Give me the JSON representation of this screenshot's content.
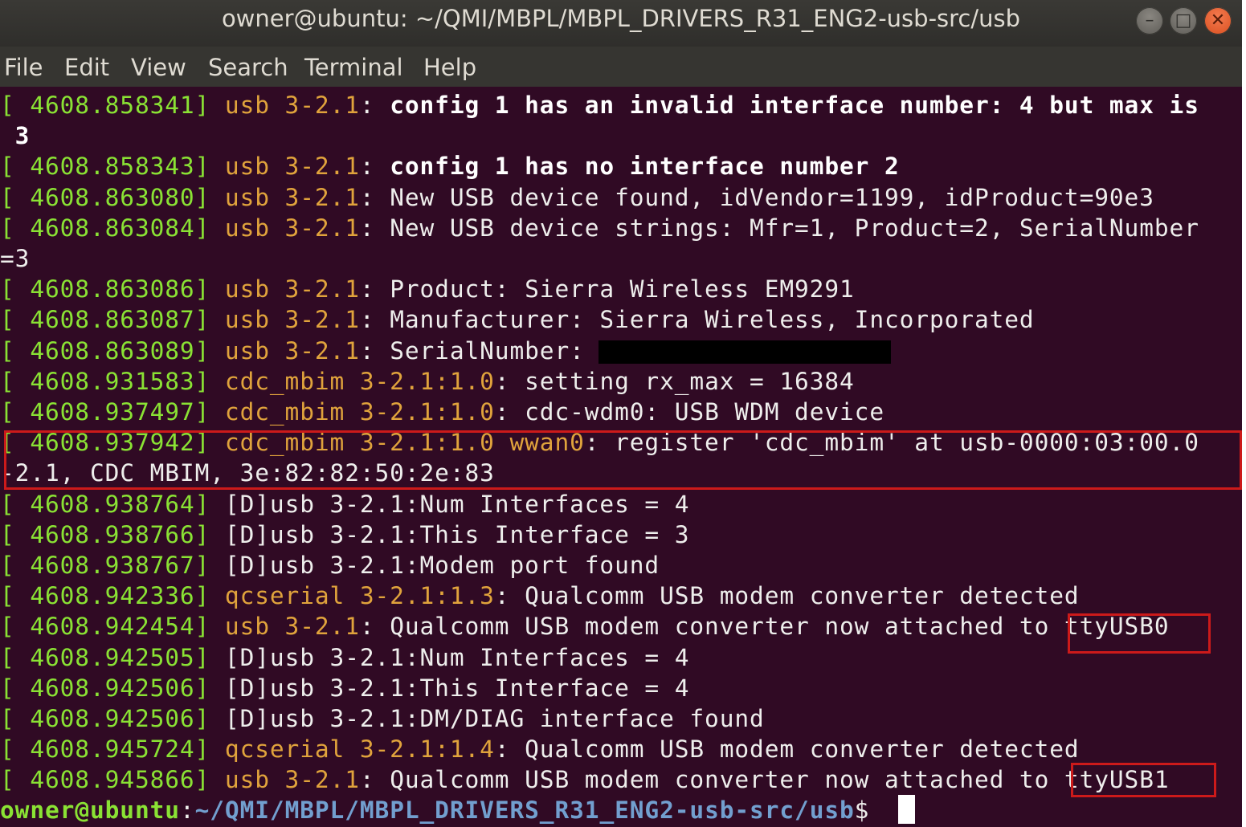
{
  "window": {
    "title": "owner@ubuntu: ~/QMI/MBPL/MBPL_DRIVERS_R31_ENG2-usb-src/usb",
    "buttons": {
      "minimize": "–",
      "maximize": "□",
      "close": "✕"
    }
  },
  "menu": [
    "File",
    "Edit",
    "View",
    "Search",
    "Terminal",
    "Help"
  ],
  "terminal": {
    "lines": [
      {
        "ts": "[ 4608.858341]",
        "dev": " usb 3-2.1",
        "sep": ": ",
        "msg": "config 1 has an invalid interface number: 4 but max is",
        "bold": true
      },
      {
        "msg": " 3",
        "bold": true
      },
      {
        "ts": "[ 4608.858343]",
        "dev": " usb 3-2.1",
        "sep": ": ",
        "msg": "config 1 has no interface number 2",
        "bold": true
      },
      {
        "ts": "[ 4608.863080]",
        "dev": " usb 3-2.1",
        "sep": ": ",
        "msg": "New USB device found, idVendor=1199, idProduct=90e3"
      },
      {
        "ts": "[ 4608.863084]",
        "dev": " usb 3-2.1",
        "sep": ": ",
        "msg": "New USB device strings: Mfr=1, Product=2, SerialNumber"
      },
      {
        "msg": "=3"
      },
      {
        "ts": "[ 4608.863086]",
        "dev": " usb 3-2.1",
        "sep": ": ",
        "msg": "Product: Sierra Wireless EM9291"
      },
      {
        "ts": "[ 4608.863087]",
        "dev": " usb 3-2.1",
        "sep": ": ",
        "msg": "Manufacturer: Sierra Wireless, Incorporated"
      },
      {
        "ts": "[ 4608.863089]",
        "dev": " usb 3-2.1",
        "sep": ": ",
        "msg": "SerialNumber:"
      },
      {
        "ts": "[ 4608.931583]",
        "dev": " cdc_mbim 3-2.1:1.0",
        "sep": ": ",
        "msg": "setting rx_max = 16384"
      },
      {
        "ts": "[ 4608.937497]",
        "dev": " cdc_mbim 3-2.1:1.0",
        "sep": ": ",
        "msg": "cdc-wdm0: USB WDM device"
      },
      {
        "ts": "[ 4608.937942]",
        "dev": " cdc_mbim 3-2.1:1.0 wwan0",
        "sep": ": ",
        "msg": "register 'cdc_mbim' at usb-0000:03:00.0"
      },
      {
        "msg": "-2.1, CDC MBIM, 3e:82:82:50:2e:83"
      },
      {
        "ts": "[ 4608.938764]",
        "dev": "",
        "sep": " ",
        "msg": "[D]usb 3-2.1:Num Interfaces = 4"
      },
      {
        "ts": "[ 4608.938766]",
        "dev": "",
        "sep": " ",
        "msg": "[D]usb 3-2.1:This Interface = 3"
      },
      {
        "ts": "[ 4608.938767]",
        "dev": "",
        "sep": " ",
        "msg": "[D]usb 3-2.1:Modem port found"
      },
      {
        "ts": "[ 4608.942336]",
        "dev": " qcserial 3-2.1:1.3",
        "sep": ": ",
        "msg": "Qualcomm USB modem converter detected"
      },
      {
        "ts": "[ 4608.942454]",
        "dev": " usb 3-2.1",
        "sep": ": ",
        "msg": "Qualcomm USB modem converter now attached to ttyUSB0"
      },
      {
        "ts": "[ 4608.942505]",
        "dev": "",
        "sep": " ",
        "msg": "[D]usb 3-2.1:Num Interfaces = 4"
      },
      {
        "ts": "[ 4608.942506]",
        "dev": "",
        "sep": " ",
        "msg": "[D]usb 3-2.1:This Interface = 4"
      },
      {
        "ts": "[ 4608.942506]",
        "dev": "",
        "sep": " ",
        "msg": "[D]usb 3-2.1:DM/DIAG interface found"
      },
      {
        "ts": "[ 4608.945724]",
        "dev": " qcserial 3-2.1:1.4",
        "sep": ": ",
        "msg": "Qualcomm USB modem converter detected"
      },
      {
        "ts": "[ 4608.945866]",
        "dev": " usb 3-2.1",
        "sep": ": ",
        "msg": "Qualcomm USB modem converter now attached to ttyUSB1"
      }
    ],
    "prompt": {
      "user": "owner@ubuntu",
      "sep": ":",
      "path": "~/QMI/MBPL/MBPL_DRIVERS_R31_ENG2-usb-src/usb",
      "symbol": "$ "
    }
  },
  "colors": {
    "background": "#300a24",
    "timestamp": "#8ae234",
    "device": "#e0a33c",
    "text": "#eeeeec",
    "path": "#729fcf",
    "highlight": "#cc1a1a"
  }
}
